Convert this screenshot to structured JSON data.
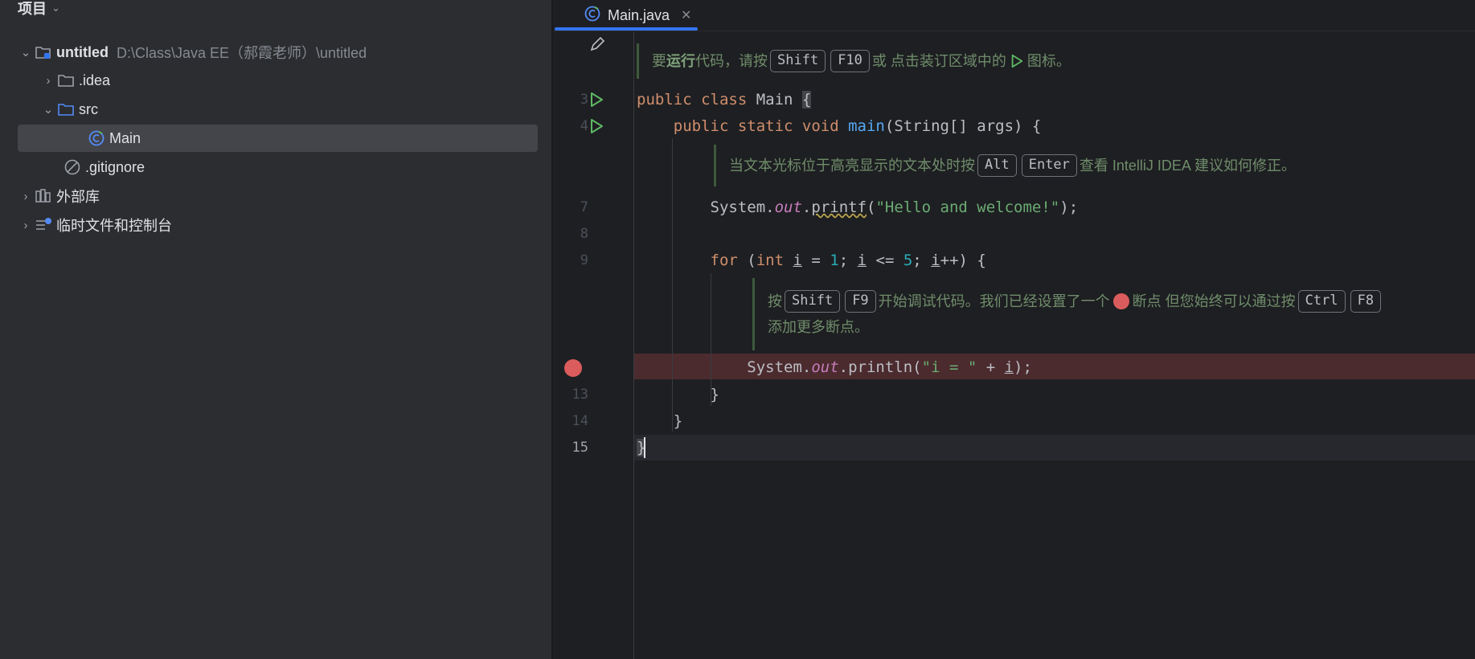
{
  "project_panel": {
    "title": "项目",
    "tree": [
      {
        "label": "untitled",
        "path": "D:\\Class\\Java EE（郝霞老师）\\untitled"
      },
      {
        "label": ".idea"
      },
      {
        "label": "src"
      },
      {
        "label": "Main"
      },
      {
        "label": ".gitignore"
      },
      {
        "label": "外部库"
      },
      {
        "label": "临时文件和控制台"
      }
    ]
  },
  "editor": {
    "tab_label": "Main.java",
    "line_numbers": {
      "l3": "3",
      "l4": "4",
      "l7": "7",
      "l8": "8",
      "l9": "9",
      "l13": "13",
      "l14": "14",
      "l15": "15"
    },
    "hint1": {
      "pre": "要",
      "bold": "运行",
      "mid": "代码，请按",
      "key1": "Shift",
      "key2": "F10",
      "post": "或 点击装订区域中的",
      "end": "图标。"
    },
    "hint2": {
      "pre": "当文本光标位于高亮显示的文本处时按",
      "key1": "Alt",
      "key2": "Enter",
      "post": "查看 IntelliJ IDEA 建议如何修正。"
    },
    "hint3": {
      "pre": "按",
      "key1": "Shift",
      "key2": "F9",
      "mid": "开始调试代码。我们已经设置了一个",
      "mid2": "断点 但您始终可以通过按",
      "key3": "Ctrl",
      "key4": "F8",
      "line2": "添加更多断点。"
    }
  },
  "colors": {
    "accent": "#3574f0",
    "breakpoint": "#db5c5c",
    "run": "#5fb865"
  }
}
